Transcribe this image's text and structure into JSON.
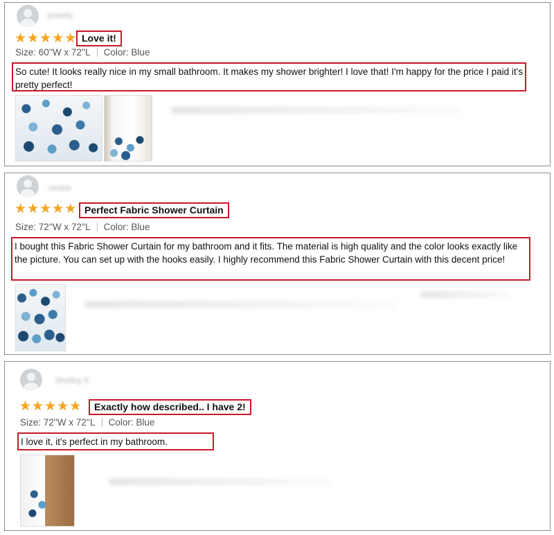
{
  "reviews": [
    {
      "user": "jewelly",
      "rating": 5,
      "title": "Love it!",
      "size": "Size: 60''W x 72''L",
      "color": "Color: Blue",
      "body": "So cute! It looks really nice in my small bathroom. It makes my shower brighter! I love that! I'm happy for the price I paid it's pretty perfect!",
      "photo_count": 2
    },
    {
      "user": "Jackie",
      "rating": 5,
      "title": "Perfect Fabric Shower Curtain",
      "size": "Size: 72''W x 72''L",
      "color": "Color: Blue",
      "body": "I bought this Fabric Shower Curtain for my bathroom and it fits. The material is high quality and the color looks exactly like the picture. You can set up with the hooks easily. I highly recommend this Fabric Shower Curtain with this decent price!",
      "photo_count": 1
    },
    {
      "user": "Shelley K",
      "rating": 5,
      "title": "Exactly how described.. I have 2!",
      "size": "Size: 72''W x 72''L",
      "color": "Color: Blue",
      "body": "I love it, it's perfect in my bathroom.",
      "photo_count": 1
    }
  ],
  "colors": {
    "star": "#f5a623",
    "highlight": "#c8182a",
    "avatar": "#cfd3d6"
  },
  "icons": {
    "avatar": "user-avatar-icon",
    "star": "star-icon"
  }
}
